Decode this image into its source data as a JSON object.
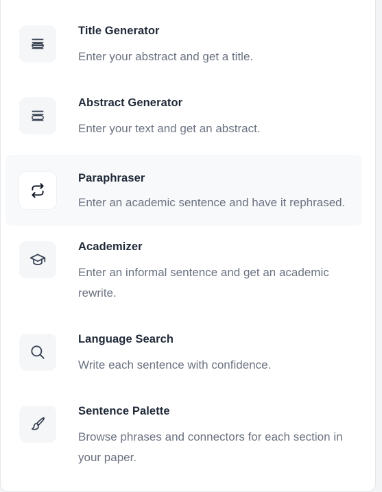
{
  "menu": {
    "items": [
      {
        "title": "Title Generator",
        "description": "Enter your abstract and get a title.",
        "icon": "text-lines-icon"
      },
      {
        "title": "Abstract Generator",
        "description": "Enter your text and get an abstract.",
        "icon": "text-lines-icon"
      },
      {
        "title": "Paraphraser",
        "description": "Enter an academic sentence and have it rephrased.",
        "icon": "refresh-icon",
        "active": true
      },
      {
        "title": "Academizer",
        "description": "Enter an informal sentence and get an academic rewrite.",
        "icon": "graduation-cap-icon"
      },
      {
        "title": "Language Search",
        "description": "Write each sentence with confidence.",
        "icon": "search-icon"
      },
      {
        "title": "Sentence Palette",
        "description": "Browse phrases and connectors for each section in your paper.",
        "icon": "paintbrush-icon"
      }
    ]
  },
  "colors": {
    "title": "#1f2937",
    "description": "#6b7280",
    "icon_stroke": "#374151",
    "active_background": "#f8f9fb"
  }
}
